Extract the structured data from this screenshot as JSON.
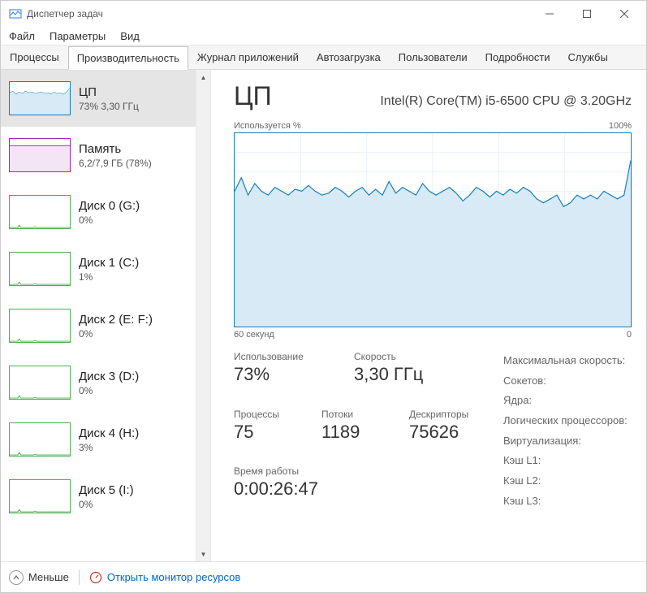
{
  "window": {
    "title": "Диспетчер задач"
  },
  "menubar": [
    "Файл",
    "Параметры",
    "Вид"
  ],
  "tabs": {
    "items": [
      "Процессы",
      "Производительность",
      "Журнал приложений",
      "Автозагрузка",
      "Пользователи",
      "Подробности",
      "Службы"
    ],
    "active_index": 1
  },
  "sidebar": [
    {
      "label": "ЦП",
      "sub": "73% 3,30 ГГц",
      "type": "cpu",
      "selected": true
    },
    {
      "label": "Память",
      "sub": "6,2/7,9 ГБ (78%)",
      "type": "mem"
    },
    {
      "label": "Диск 0 (G:)",
      "sub": "0%",
      "type": "disk"
    },
    {
      "label": "Диск 1 (C:)",
      "sub": "1%",
      "type": "disk"
    },
    {
      "label": "Диск 2 (E: F:)",
      "sub": "0%",
      "type": "disk"
    },
    {
      "label": "Диск 3 (D:)",
      "sub": "0%",
      "type": "disk"
    },
    {
      "label": "Диск 4 (H:)",
      "sub": "3%",
      "type": "disk"
    },
    {
      "label": "Диск 5 (I:)",
      "sub": "0%",
      "type": "disk"
    }
  ],
  "detail": {
    "title": "ЦП",
    "subtitle": "Intel(R) Core(TM) i5-6500 CPU @ 3.20GHz",
    "y_label": "Используется %",
    "y_max": "100%",
    "x_left": "60 секунд",
    "x_right": "0"
  },
  "stats": {
    "usage_label": "Использование",
    "usage_value": "73%",
    "speed_label": "Скорость",
    "speed_value": "3,30 ГГц",
    "proc_label": "Процессы",
    "proc_value": "75",
    "threads_label": "Потоки",
    "threads_value": "1189",
    "handles_label": "Дескрипторы",
    "handles_value": "75626",
    "uptime_label": "Время работы",
    "uptime_value": "0:00:26:47"
  },
  "meta": {
    "maxspeed": "Максимальная скорость:",
    "sockets": "Сокетов:",
    "cores": "Ядра:",
    "logical": "Логических процессоров:",
    "virt": "Виртуализация:",
    "l1": "Кэш L1:",
    "l2": "Кэш L2:",
    "l3": "Кэш L3:"
  },
  "footer": {
    "less": "Меньше",
    "resmon": "Открыть монитор ресурсов"
  },
  "colors": {
    "cpu_stroke": "#117dbb",
    "cpu_fill": "#d7eaf5",
    "disk_stroke": "#4caf50",
    "mem_stroke": "#9c27b0"
  },
  "chart_data": {
    "type": "line",
    "title": "Используется %",
    "xlabel": "60 секунд",
    "ylabel": "",
    "ylim": [
      0,
      100
    ],
    "x": [
      0,
      1,
      2,
      3,
      4,
      5,
      6,
      7,
      8,
      9,
      10,
      11,
      12,
      13,
      14,
      15,
      16,
      17,
      18,
      19,
      20,
      21,
      22,
      23,
      24,
      25,
      26,
      27,
      28,
      29,
      30,
      31,
      32,
      33,
      34,
      35,
      36,
      37,
      38,
      39,
      40,
      41,
      42,
      43,
      44,
      45,
      46,
      47,
      48,
      49,
      50,
      51,
      52,
      53,
      54,
      55,
      56,
      57,
      58,
      59
    ],
    "values": [
      70,
      77,
      68,
      74,
      70,
      68,
      72,
      70,
      68,
      71,
      70,
      73,
      70,
      68,
      69,
      72,
      70,
      67,
      70,
      72,
      68,
      71,
      68,
      75,
      69,
      72,
      70,
      68,
      74,
      70,
      68,
      70,
      72,
      69,
      65,
      68,
      72,
      70,
      67,
      70,
      68,
      71,
      69,
      72,
      70,
      66,
      64,
      66,
      68,
      62,
      64,
      68,
      66,
      68,
      66,
      70,
      68,
      66,
      68,
      86
    ]
  }
}
